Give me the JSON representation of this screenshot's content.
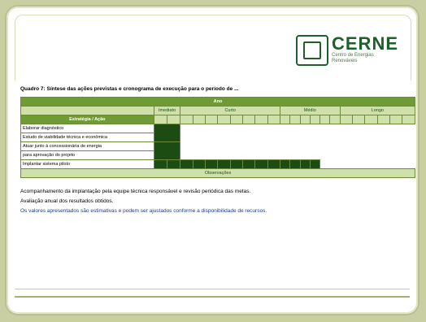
{
  "logo": {
    "brand": "CERNE",
    "subtitle": "Centro de Energias Renováveis"
  },
  "caption": "Quadro 7: Síntese das ações previstas e cronograma de execução para o período de ...",
  "table": {
    "top_band": "Ano",
    "group_headers": [
      "Imediato",
      "Curto",
      "Médio",
      "Longo"
    ],
    "subheader_label": "Estratégia / Ação",
    "rows": [
      {
        "line1": "Elaborar diagnóstico",
        "line2": "Estudo de viabilidade técnica e econômica"
      },
      {
        "line1": "Atuar junto à concessionária de energia",
        "line2": "para aprovação do projeto"
      },
      {
        "line1": "Implantar sistema piloto",
        "line2": ""
      }
    ],
    "bottom_band": "Observações"
  },
  "notes": [
    "Acompanhamento da implantação pela equipe técnica responsável e revisão periódica das metas.",
    "Avaliação anual dos resultados obtidos.",
    "Os valores apresentados são estimativas e podem ser ajustados conforme a disponibilidade de recursos."
  ]
}
